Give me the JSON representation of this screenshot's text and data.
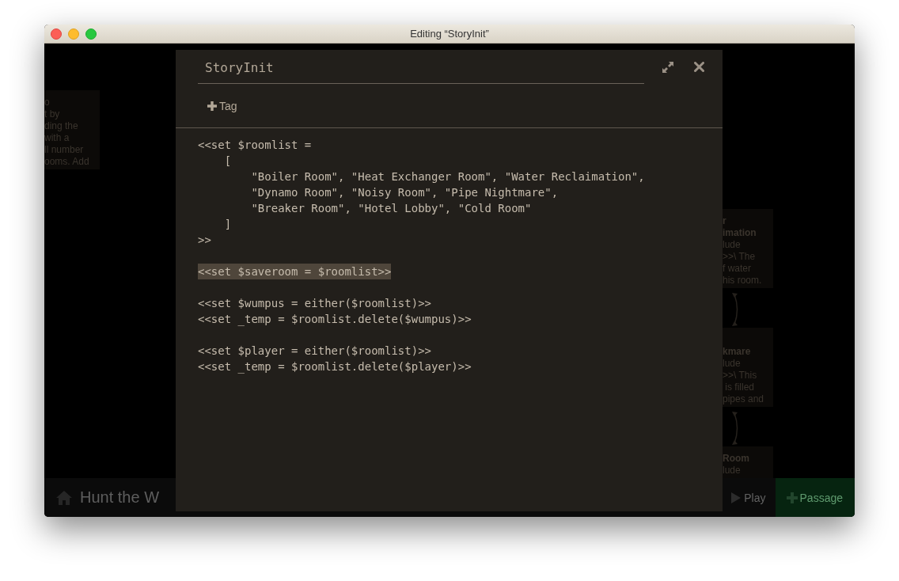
{
  "window": {
    "title": "Editing “StoryInit”"
  },
  "story_map": {
    "cards": [
      {
        "lines": [
          {
            "text": "o",
            "bold": false
          },
          {
            "text": "t by",
            "bold": false
          },
          {
            "text": "ding the",
            "bold": false
          },
          {
            "text": "with a",
            "bold": false
          },
          {
            "text": "ll number",
            "bold": false
          },
          {
            "text": "ooms. Add",
            "bold": false
          }
        ]
      },
      {
        "lines": [
          {
            "text": "r",
            "bold": true
          },
          {
            "text": "imation",
            "bold": true
          },
          {
            "text": "lude",
            "bold": false
          },
          {
            "text": ">>\\ The",
            "bold": false
          },
          {
            "text": "f water",
            "bold": false
          },
          {
            "text": "his room.",
            "bold": false
          }
        ]
      },
      {
        "lines": [
          {
            "text": "kmare",
            "bold": true
          },
          {
            "text": "lude",
            "bold": false
          },
          {
            "text": ">>\\ This",
            "bold": false
          },
          {
            "text": " is filled",
            "bold": false
          },
          {
            "text": "pipes and",
            "bold": false
          }
        ]
      },
      {
        "lines": [
          {
            "text": "Room",
            "bold": true
          },
          {
            "text": "lude",
            "bold": false
          }
        ]
      }
    ]
  },
  "toolbar": {
    "story_title": "Hunt the W",
    "play": "Play",
    "add_passage": "Passage"
  },
  "dialog": {
    "title": "StoryInit",
    "tag_button": "Tag",
    "code_blocks": [
      {
        "lines": [
          {
            "text": "<<set $roomlist =",
            "selected": false
          },
          {
            "text": "    [",
            "selected": false
          },
          {
            "text": "        \"Boiler Room\", \"Heat Exchanger Room\", \"Water Reclaimation\",",
            "selected": false
          },
          {
            "text": "        \"Dynamo Room\", \"Noisy Room\", \"Pipe Nightmare\",",
            "selected": false
          },
          {
            "text": "        \"Breaker Room\", \"Hotel Lobby\", \"Cold Room\"",
            "selected": false
          },
          {
            "text": "    ]",
            "selected": false
          },
          {
            "text": ">>",
            "selected": false
          }
        ]
      },
      {
        "lines": [
          {
            "text": "<<set $saveroom = $roomlist>>",
            "selected": true
          }
        ]
      },
      {
        "lines": [
          {
            "text": "<<set $wumpus = either($roomlist)>>",
            "selected": false
          },
          {
            "text": "<<set _temp = $roomlist.delete($wumpus)>>",
            "selected": false
          }
        ]
      },
      {
        "lines": [
          {
            "text": "<<set $player = either($roomlist)>>",
            "selected": false
          },
          {
            "text": "<<set _temp = $roomlist.delete($player)>>",
            "selected": false
          }
        ]
      }
    ]
  }
}
